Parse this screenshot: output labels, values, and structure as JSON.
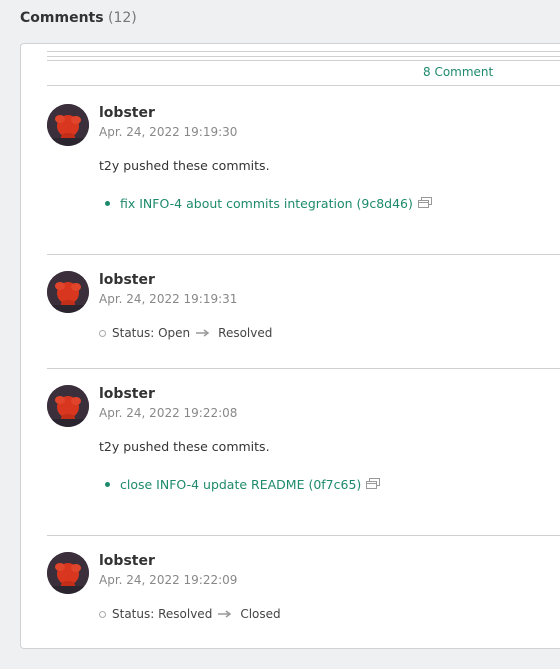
{
  "header": {
    "title": "Comments",
    "count": "(12)"
  },
  "comment_count_link": "8 Comment",
  "entries": [
    {
      "author": "lobster",
      "timestamp": "Apr. 24, 2022 19:19:30",
      "body": "t2y pushed these commits.",
      "commit": "fix INFO-4 about commits integration (9c8d46)"
    },
    {
      "author": "lobster",
      "timestamp": "Apr. 24, 2022 19:19:31",
      "status_label": "Status: Open",
      "status_to": "Resolved"
    },
    {
      "author": "lobster",
      "timestamp": "Apr. 24, 2022 19:22:08",
      "body": "t2y pushed these commits.",
      "commit": "close INFO-4 update README (0f7c65)"
    },
    {
      "author": "lobster",
      "timestamp": "Apr. 24, 2022 19:22:09",
      "status_label": "Status: Resolved",
      "status_to": "Closed"
    }
  ],
  "colors": {
    "link": "#1d8a6c",
    "avatar_bg": "#3a2f3a",
    "avatar_lobster": "#d8361f"
  },
  "icons": {
    "commit_link": "new-window-icon",
    "status_change": "arrow-right-icon",
    "avatar": "lobster-avatar"
  }
}
